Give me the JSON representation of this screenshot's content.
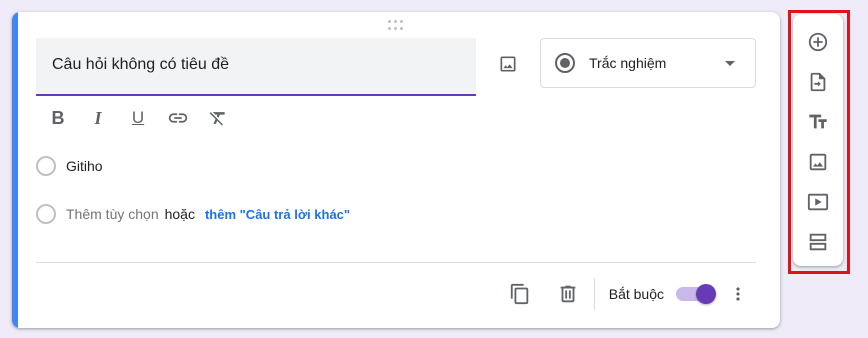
{
  "question": {
    "title": "Câu hỏi không có tiêu đề",
    "type_label": "Trắc nghiệm"
  },
  "format_toolbar": {
    "bold": "B",
    "italic": "I",
    "underline": "U"
  },
  "options": [
    {
      "label": "Gitiho"
    }
  ],
  "add_option": {
    "add_label": "Thêm tùy chọn",
    "or_label": "hoặc",
    "other_label": "thêm \"Câu trả lời khác\""
  },
  "footer": {
    "required_label": "Bắt buộc",
    "required_on": true
  },
  "side_toolbar": {
    "items": [
      "add-question-icon",
      "import-questions-icon",
      "add-title-icon",
      "add-image-icon",
      "add-video-icon",
      "add-section-icon"
    ]
  },
  "colors": {
    "accent": "#673ab7",
    "left_bar": "#4285f4",
    "link": "#1a73e8",
    "highlight_outline": "#e0131a"
  }
}
